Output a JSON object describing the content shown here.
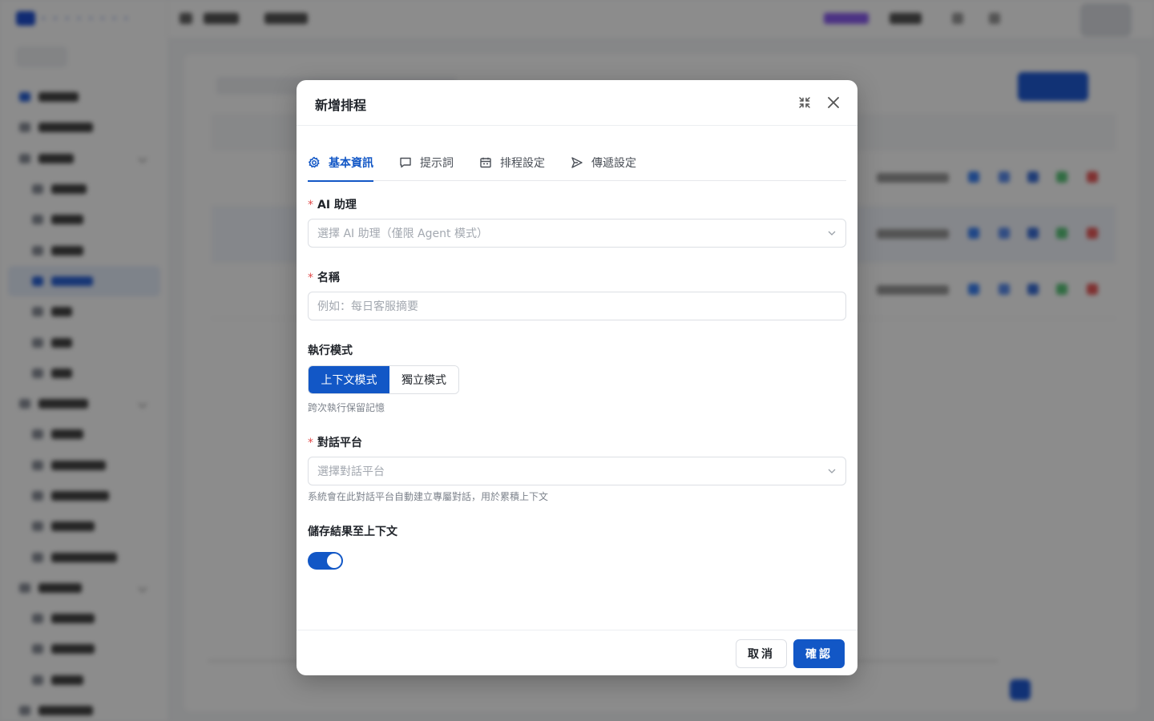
{
  "modal": {
    "title": "新增排程",
    "tabs": [
      {
        "label": "基本資訊",
        "icon": "gear-icon",
        "active": true
      },
      {
        "label": "提示詞",
        "icon": "message-icon",
        "active": false
      },
      {
        "label": "排程設定",
        "icon": "calendar-icon",
        "active": false
      },
      {
        "label": "傳遞設定",
        "icon": "send-icon",
        "active": false
      }
    ],
    "assistant": {
      "label": "AI 助理",
      "placeholder": "選擇 AI 助理（僅限 Agent 模式）"
    },
    "name": {
      "label": "名稱",
      "placeholder": "例如：每日客服摘要"
    },
    "mode": {
      "label": "執行模式",
      "options": [
        "上下文模式",
        "獨立模式"
      ],
      "selected": "上下文模式",
      "hint": "跨次執行保留記憶"
    },
    "platform": {
      "label": "對話平台",
      "placeholder": "選擇對話平台",
      "hint": "系統會在此對話平台自動建立專屬對話，用於累積上下文"
    },
    "save_result": {
      "label": "儲存結果至上下文",
      "enabled": true
    },
    "footer": {
      "cancel_label": "取消",
      "confirm_label": "確認"
    }
  },
  "colors": {
    "primary": "#1257c6",
    "required": "#e14b4b",
    "overlay": "#000000"
  }
}
